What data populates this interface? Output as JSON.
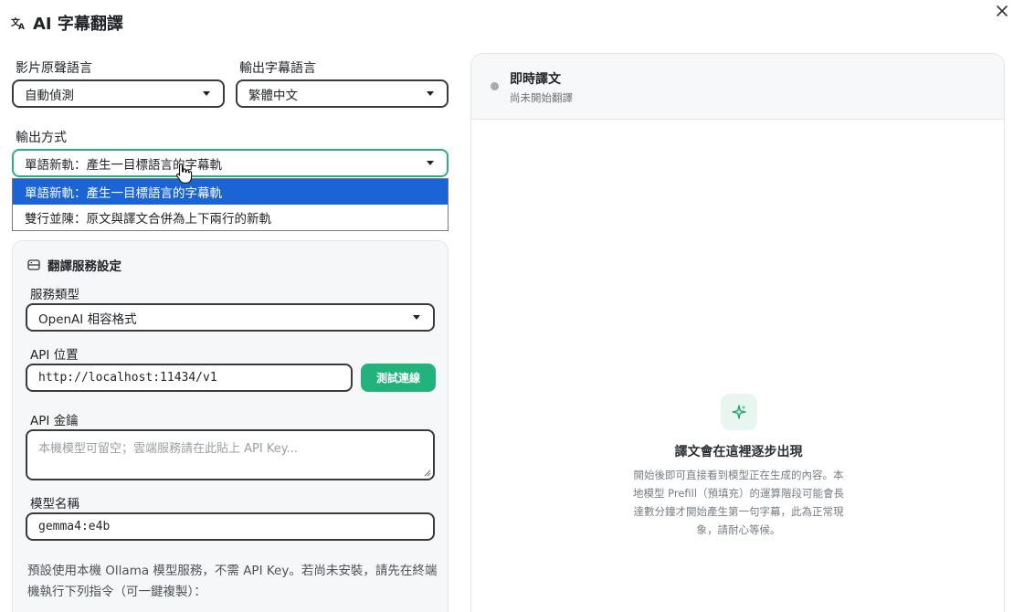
{
  "dialog": {
    "title": "AI 字幕翻譯"
  },
  "source_language": {
    "label": "影片原聲語言",
    "value": "自動偵測"
  },
  "target_language": {
    "label": "輸出字幕語言",
    "value": "繁體中文"
  },
  "output_mode": {
    "label": "輸出方式",
    "value": "單語新軌：產生一目標語言的字幕軌",
    "options": [
      "單語新軌：產生一目標語言的字幕軌",
      "雙行並陳：原文與譯文合併為上下兩行的新軌"
    ]
  },
  "service": {
    "heading": "翻譯服務設定",
    "type_label": "服務類型",
    "type_value": "OpenAI 相容格式",
    "api_url_label": "API 位置",
    "api_url_value": "http://localhost:11434/v1",
    "test_button": "測試連線",
    "api_key_label": "API 金鑰",
    "api_key_placeholder": "本機模型可留空；雲端服務請在此貼上 API Key...",
    "model_label": "模型名稱",
    "model_value": "gemma4:e4b",
    "hint": "預設使用本機 Ollama 模型服務，不需 API Key。若尚未安裝，請先在終端機執行下列指令（可一鍵複製）："
  },
  "live_translation": {
    "title": "即時譯文",
    "status": "尚未開始翻譯",
    "empty_title": "譯文會在這裡逐步出現",
    "empty_desc": "開始後即可直接看到模型正在生成的內容。本地模型 Prefill（預填充）的運算階段可能會長達數分鐘才開始產生第一句字幕，此為正常現象，請耐心等候。"
  },
  "colors": {
    "accent": "#22b27c",
    "focus_border": "#2bb07f",
    "selected_option": "#1a64d6",
    "status_idle": "#a6abb1"
  },
  "icons": {
    "title": "translate-icon",
    "close": "close-icon",
    "service": "server-icon",
    "empty_state": "sparkle-icon",
    "cursor": "hand-pointer-icon"
  }
}
